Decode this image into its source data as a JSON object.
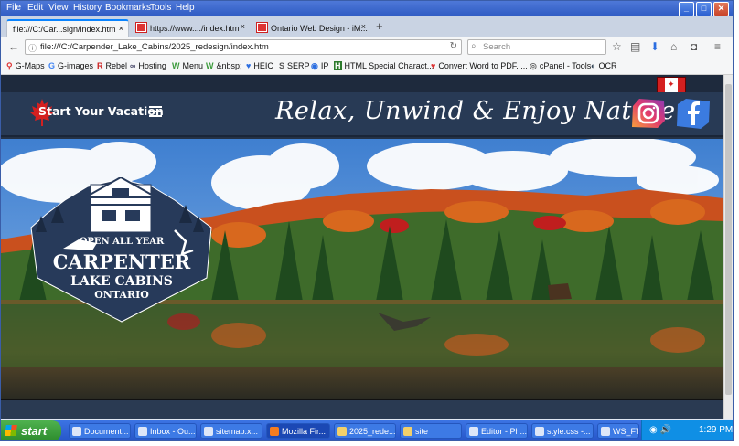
{
  "menubar": {
    "items": [
      "File",
      "Edit",
      "View",
      "History",
      "Bookmarks",
      "Tools",
      "Help"
    ],
    "controls": {
      "minimize": "_",
      "maximize": "□",
      "close": "✕"
    }
  },
  "tabs": [
    {
      "label": "file:///C:/Car...sign/index.htm",
      "close": "×"
    },
    {
      "label": "https://www..../index.htm",
      "close": "×"
    },
    {
      "label": "Ontario Web Design - iM...",
      "close": "×"
    }
  ],
  "new_tab": "+",
  "navbar": {
    "back": "←",
    "url": "file:///C:/Carpender_Lake_Cabins/2025_redesign/index.htm",
    "search_placeholder": "Search"
  },
  "bookmarks": [
    {
      "icon": "pin",
      "label": "G-Maps"
    },
    {
      "icon": "G",
      "label": "G-images"
    },
    {
      "icon": "R",
      "label": "Rebel"
    },
    {
      "icon": "∞",
      "label": "Hosting"
    },
    {
      "icon": "W",
      "label": "Menu"
    },
    {
      "icon": "W",
      "label": "&nbsp;"
    },
    {
      "icon": "♥",
      "label": "HEIC"
    },
    {
      "icon": "S",
      "label": "SERP"
    },
    {
      "icon": "◉",
      "label": "IP"
    },
    {
      "icon": "H",
      "label": "HTML Special Charact..."
    },
    {
      "icon": "♥",
      "label": "Convert Word to PDF. ..."
    },
    {
      "icon": "◎",
      "label": "cPanel - Tools"
    },
    {
      "icon": "◐",
      "label": "OCR"
    }
  ],
  "site": {
    "nav_label": "Start Your Vacation",
    "tagline": "Relax, Unwind & Enjoy Nature",
    "logo": {
      "open_text": "OPEN ALL YEAR",
      "name_line1": "CARPENTER",
      "name_line2": "LAKE CABINS",
      "name_line3": "ONTARIO"
    }
  },
  "taskbar": {
    "start_label": "start",
    "buttons": [
      "Document...",
      "Inbox - Ou...",
      "sitemap.x...",
      "Mozilla Fir...",
      "2025_rede...",
      "site",
      "Editor - Ph...",
      "style.css -...",
      "WS_FTP9..."
    ],
    "clock": "1:29 PM"
  },
  "colors": {
    "header_bg": "#283a55",
    "accent": "#0a84ff",
    "taskbar": "#2655c8"
  }
}
